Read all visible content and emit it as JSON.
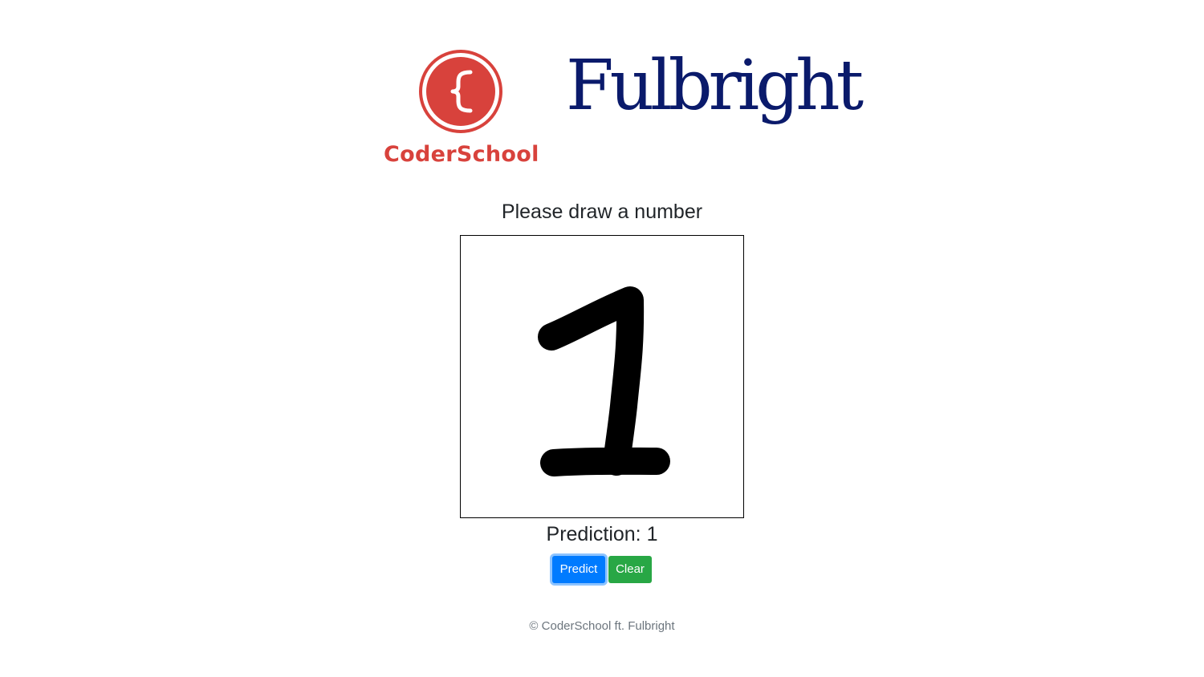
{
  "logos": {
    "coderschool_name": "CoderSchool",
    "fulbright_name": "Fulbright",
    "coderschool_color": "#d8423c",
    "fulbright_color": "#0a1a6b"
  },
  "instruction": "Please draw a number",
  "canvas": {
    "drawn_digit": "1",
    "stroke_color": "#000000"
  },
  "prediction_text": "Prediction: 1",
  "buttons": {
    "predict_label": "Predict",
    "clear_label": "Clear",
    "predict_color": "#007bff",
    "clear_color": "#28a745"
  },
  "footer": "© CoderSchool ft. Fulbright"
}
